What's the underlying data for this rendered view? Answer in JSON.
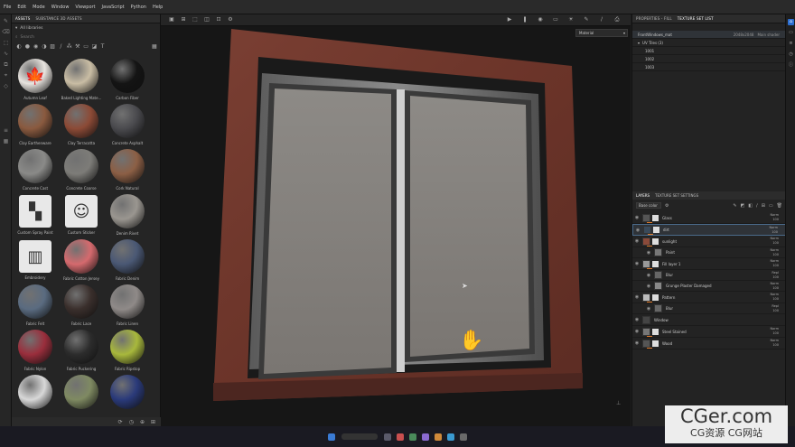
{
  "menu": [
    "File",
    "Edit",
    "Mode",
    "Window",
    "Viewport",
    "JavaScript",
    "Python",
    "Help"
  ],
  "assets": {
    "tabs": [
      "ASSETS",
      "SUBSTANCE 3D ASSETS"
    ],
    "library": "All libraries",
    "search_placeholder": "Search",
    "items": [
      {
        "label": "Autumn Leaf",
        "kind": "sphere",
        "color": "#e8e4df",
        "glyph": "🍁"
      },
      {
        "label": "Baked Lighting Mate...",
        "kind": "sphere",
        "color": "#c9bda4"
      },
      {
        "label": "Carbon Fiber",
        "kind": "sphere",
        "color": "#141414"
      },
      {
        "label": "Clay Earthenware",
        "kind": "sphere",
        "color": "#8a5a3f"
      },
      {
        "label": "Clay Terracotta",
        "kind": "sphere",
        "color": "#8c4a36"
      },
      {
        "label": "Concrete Asphalt",
        "kind": "sphere",
        "color": "#4a4a4e"
      },
      {
        "label": "Concrete Cast",
        "kind": "sphere",
        "color": "#8a8a88"
      },
      {
        "label": "Concrete Coarse",
        "kind": "sphere",
        "color": "#7d7c78"
      },
      {
        "label": "Cork Natural",
        "kind": "sphere",
        "color": "#8c5f45"
      },
      {
        "label": "Custom Spray Paint",
        "kind": "square",
        "glyph": "▚"
      },
      {
        "label": "Custom Sticker",
        "kind": "square",
        "glyph": "☺"
      },
      {
        "label": "Denim Rivet",
        "kind": "sphere",
        "color": "#9a9690"
      },
      {
        "label": "Embroidery",
        "kind": "square",
        "glyph": "▥"
      },
      {
        "label": "Fabric Cotton Jersey",
        "kind": "sphere",
        "color": "#d56a6e"
      },
      {
        "label": "Fabric Denim",
        "kind": "sphere",
        "color": "#4a5874"
      },
      {
        "label": "Fabric Felt",
        "kind": "sphere",
        "color": "#5a6b80"
      },
      {
        "label": "Fabric Lace",
        "kind": "sphere",
        "color": "#3a2f2c"
      },
      {
        "label": "Fabric Linen",
        "kind": "sphere",
        "color": "#8f8a88"
      },
      {
        "label": "Fabric Nylon",
        "kind": "sphere",
        "color": "#9a2e3c"
      },
      {
        "label": "Fabric Puckering",
        "kind": "sphere",
        "color": "#2c2c2c"
      },
      {
        "label": "Fabric Ripstop",
        "kind": "sphere",
        "color": "#a8b83c"
      },
      {
        "label": "",
        "kind": "sphere",
        "color": "#d8d8d8"
      },
      {
        "label": "",
        "kind": "sphere",
        "color": "#7f8a62"
      },
      {
        "label": "",
        "kind": "sphere",
        "color": "#2a3a7a"
      }
    ]
  },
  "viewport": {
    "material_select": "Material"
  },
  "properties": {
    "tabs": [
      "PROPERTIES - FILL",
      "TEXTURE SET LIST"
    ],
    "texture_set": {
      "name": "FrontWindows_mat",
      "size": "2048x2048",
      "shader": "Main shader"
    },
    "uv_tiles": "UV Tiles (3)",
    "tiles": [
      "1001",
      "1002",
      "1003"
    ]
  },
  "layers": {
    "tabs": [
      "LAYERS",
      "TEXTURE SET SETTINGS"
    ],
    "channel": "Base color",
    "items": [
      {
        "name": "Glass",
        "blend": "Norm",
        "opacity": "100",
        "level": 0,
        "thumb": "#555555"
      },
      {
        "name": "dirt",
        "blend": "Norm",
        "opacity": "100",
        "level": 0,
        "thumb": "#3a4a5a",
        "selected": true
      },
      {
        "name": "sunlight",
        "blend": "Norm",
        "opacity": "100",
        "level": 0,
        "thumb": "#8a4a3a"
      },
      {
        "name": "Paint",
        "blend": "Norm",
        "opacity": "100",
        "level": 1,
        "thumb": "#777777"
      },
      {
        "name": "Fill layer 1",
        "blend": "Norm",
        "opacity": "100",
        "level": 0,
        "thumb": "#999999"
      },
      {
        "name": "Blur",
        "blend": "Repl",
        "opacity": "100",
        "level": 1,
        "thumb": "#666666"
      },
      {
        "name": "Grunge Plaster Damaged",
        "blend": "Norm",
        "opacity": "100",
        "level": 1,
        "thumb": "#888888"
      },
      {
        "name": "Pattern",
        "blend": "Norm",
        "opacity": "100",
        "level": 0,
        "thumb": "#bbbbbb"
      },
      {
        "name": "Blur",
        "blend": "Repl",
        "opacity": "100",
        "level": 1,
        "thumb": "#666666"
      },
      {
        "name": "Window",
        "blend": "",
        "opacity": "",
        "level": 0,
        "thumb": "#444444"
      },
      {
        "name": "Steel Stained",
        "blend": "Norm",
        "opacity": "100",
        "level": 0,
        "thumb": "#777777"
      },
      {
        "name": "Wood",
        "blend": "Norm",
        "opacity": "100",
        "level": 0,
        "thumb": "#555555"
      }
    ]
  },
  "watermark": {
    "big": "CGer.com",
    "small": "CG资源 CG网站"
  }
}
